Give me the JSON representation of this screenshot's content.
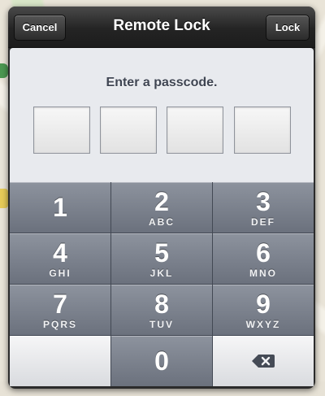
{
  "header": {
    "title": "Remote Lock",
    "cancel_label": "Cancel",
    "lock_label": "Lock"
  },
  "passcode": {
    "prompt": "Enter a passcode."
  },
  "keypad": {
    "keys": [
      {
        "num": "1",
        "letters": ""
      },
      {
        "num": "2",
        "letters": "ABC"
      },
      {
        "num": "3",
        "letters": "DEF"
      },
      {
        "num": "4",
        "letters": "GHI"
      },
      {
        "num": "5",
        "letters": "JKL"
      },
      {
        "num": "6",
        "letters": "MNO"
      },
      {
        "num": "7",
        "letters": "PQRS"
      },
      {
        "num": "8",
        "letters": "TUV"
      },
      {
        "num": "9",
        "letters": "WXYZ"
      },
      {
        "num": "0",
        "letters": ""
      }
    ],
    "delete_icon": "backspace-icon"
  },
  "colors": {
    "key_dark": "#6b717d",
    "key_light": "#e8eaee",
    "bar_dark": "#242424"
  }
}
